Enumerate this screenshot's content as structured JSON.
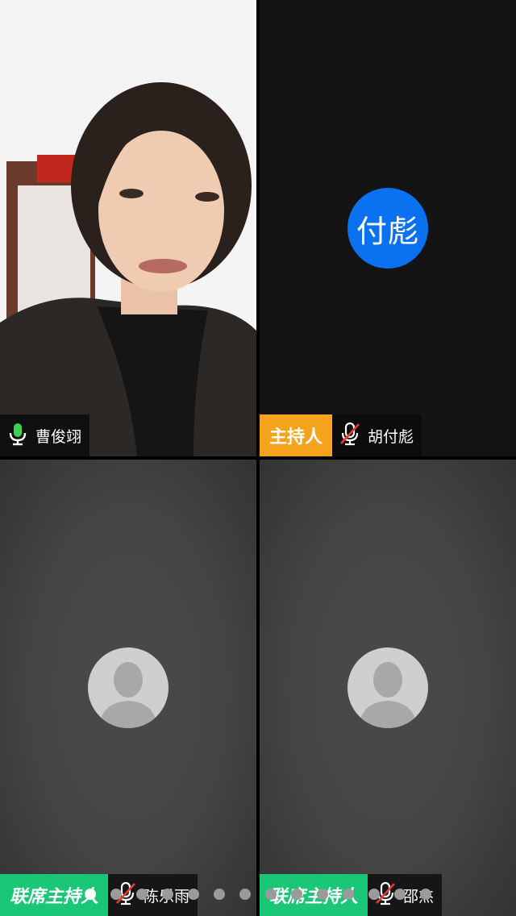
{
  "participants": [
    {
      "name": "曹俊翊",
      "role": "",
      "mic": "on",
      "display": "video"
    },
    {
      "name": "胡付彪",
      "role": "主持人",
      "mic": "muted",
      "display": "initials",
      "initials": "付彪"
    },
    {
      "name": "陈乐雨",
      "role": "联席主持人",
      "mic": "muted",
      "display": "default-avatar"
    },
    {
      "name": "邵杰",
      "role": "联席主持人",
      "mic": "muted",
      "display": "default-avatar"
    }
  ],
  "pagination": {
    "total": 14,
    "active_index": 0
  },
  "colors": {
    "host_badge": "#f5a21d",
    "cohost_badge": "#19c776",
    "initials_avatar": "#0a72f0",
    "mic_on": "#3bd34b",
    "mic_muted_slash": "#e83b2e"
  }
}
